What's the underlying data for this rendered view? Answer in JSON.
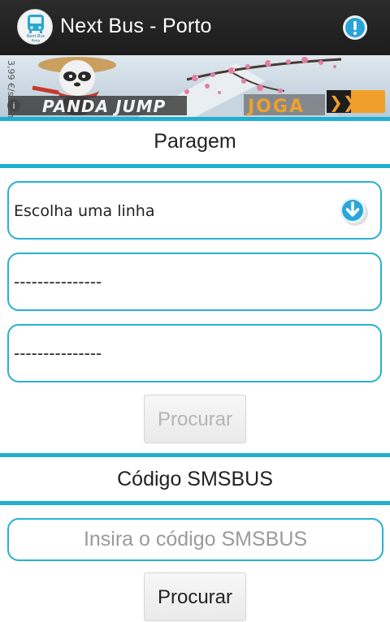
{
  "app": {
    "title": "Next Bus - Porto",
    "icon": "bus-logo-icon",
    "logo_text_1": "Next Bus",
    "logo_text_2": "Porto",
    "info_icon": "info-icon"
  },
  "ad": {
    "game_name": "PANDA JUMP",
    "cta": "JOGA",
    "side_text": "3,99 €/s → m",
    "info_glyph": "i",
    "arrows": "❯❯"
  },
  "paragem": {
    "title": "Paragem",
    "line_select": "Escolha uma linha",
    "direction_select": "---------------",
    "stop_select": "---------------",
    "search_label": "Procurar"
  },
  "sms": {
    "title": "Código SMSBUS",
    "placeholder": "Insira o código SMSBUS",
    "search_label": "Procurar"
  },
  "colors": {
    "accent": "#1fb0d0",
    "action_bar": "#222222",
    "disabled_text": "#b5b5b5"
  }
}
